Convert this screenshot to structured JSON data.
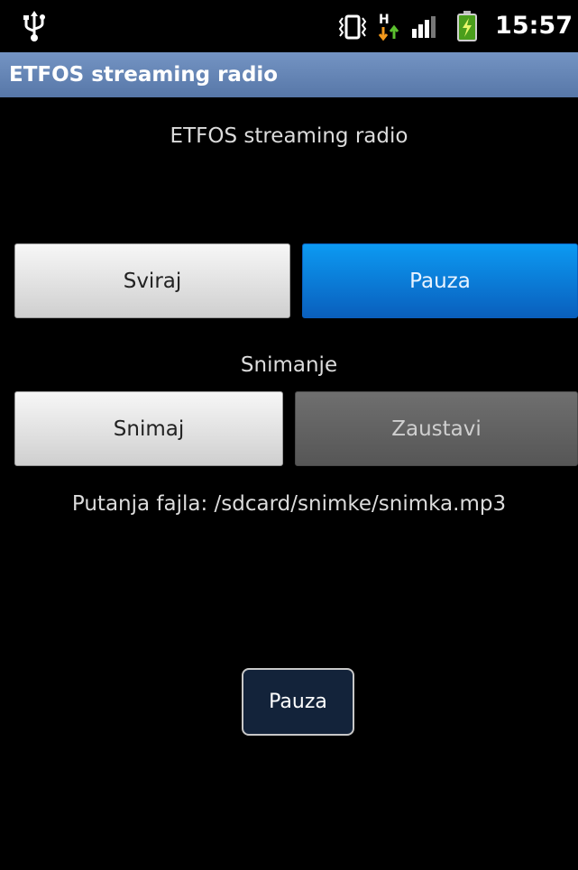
{
  "status_bar": {
    "time": "15:57",
    "icons": [
      "usb-icon",
      "vibrate-icon",
      "hspa-network-icon",
      "signal-icon",
      "battery-charging-icon"
    ]
  },
  "app": {
    "title": "ETFOS streaming radio"
  },
  "main": {
    "heading": "ETFOS streaming radio",
    "play_label": "Sviraj",
    "pause_label": "Pauza",
    "recording_label": "Snimanje",
    "record_label": "Snimaj",
    "stop_label": "Zaustavi",
    "file_path": "Putanja fajla: /sdcard/snimke/snimka.mp3",
    "bottom_pause_label": "Pauza"
  },
  "colors": {
    "title_bar": "#6688b8",
    "accent_button": "#0a7fdb",
    "disabled_button": "#606060",
    "background": "#000000"
  }
}
